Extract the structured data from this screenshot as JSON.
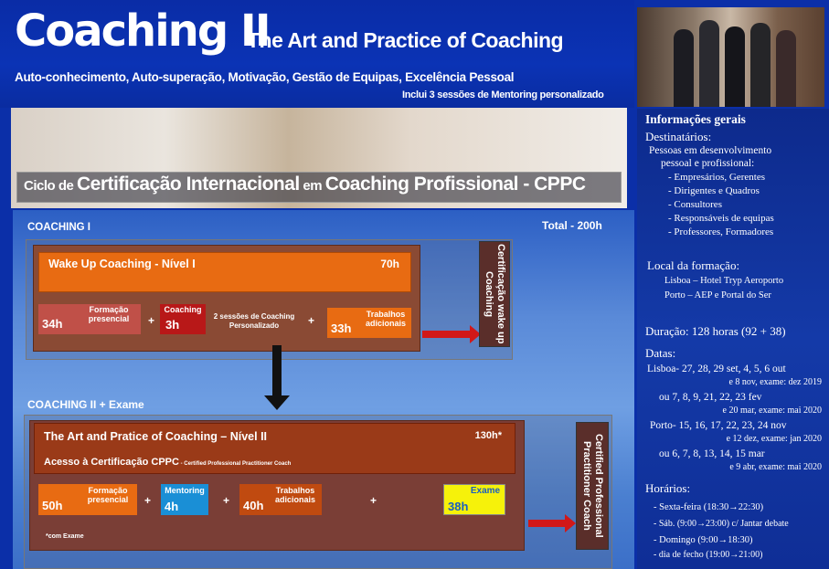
{
  "header": {
    "title_main": "Coaching II",
    "title_sub": "The  Art and Practice  of Coaching",
    "tagline": "Auto-conhecimento, Auto-superação, Motivação, Gestão de Equipas, Excelência Pessoal",
    "mentoring_note": "Inclui 3 sessões de Mentoring personalizado"
  },
  "banner": {
    "cppc_small1": "Ciclo de ",
    "cppc_big1": "Certificação Internacional",
    "cppc_small2": " em ",
    "cppc_big2": "Coaching Profissional  -  CPPC"
  },
  "coaching1": {
    "label": "COACHING I",
    "total": "Total - 200h",
    "module_title": "Wake Up Coaching - Nível I",
    "module_hours": "70h",
    "formacao_hours": "34h",
    "formacao_label": "Formação presencial",
    "coaching_label": "Coaching",
    "coaching_hours": "3h",
    "sessoes_label": "2 sessões de Coaching  Personalizado",
    "trabalhos_hours": "33h",
    "trabalhos_label": "Trabalhos adicionais",
    "certification": "Certificação wake up Coaching",
    "plus": "+"
  },
  "coaching2": {
    "label": "COACHING II + Exame",
    "module_title": "The Art and Pratice of Coaching – Nível II",
    "module_hours": "130h*",
    "access": "Acesso à Certificação CPPC",
    "access_small": " - Certified Professional Practitioner Coach",
    "formacao_hours": "50h",
    "formacao_label": "Formação presencial",
    "mentoring_label": "Mentoring",
    "mentoring_hours": "4h",
    "trabalhos_hours": "40h",
    "trabalhos_label": "Trabalhos adicionais",
    "exame_label": "Exame",
    "exame_hours": "38h",
    "com_exame": "*com Exame",
    "certification": "Certified Professional Practitioner Coach",
    "plus": "+"
  },
  "sidebar": {
    "info_title": "Informações gerais",
    "destinatarios_title": "Destinatários:",
    "dest_line1": "Pessoas em desenvolvimento",
    "dest_line2": "pessoal e profissional:",
    "dest_items": [
      "- Empresários, Gerentes",
      "- Dirigentes e Quadros",
      "- Consultores",
      "- Responsáveis de equipas",
      "- Professores, Formadores"
    ],
    "local_title": "Local da formação:",
    "local_lisboa": "Lisboa – Hotel Tryp Aeroporto",
    "local_porto": "Porto –   AEP e Portal do Ser",
    "duracao": "Duração:  128 horas (92 + 38)",
    "datas_title": "Datas:",
    "datas_lisboa_1": "Lisboa-  27, 28, 29 set, 4, 5, 6 out",
    "datas_lisboa_2": "e 8 nov, exame: dez 2019",
    "datas_lisboa_ou_1": "ou     7, 8, 9, 21, 22, 23 fev",
    "datas_lisboa_ou_2": "e 20 mar, exame: mai  2020",
    "datas_porto_1": "Porto-  15, 16, 17, 22, 23, 24 nov",
    "datas_porto_2": "e 12 dez,   exame:  jan 2020",
    "datas_porto_ou_1": "ou      6, 7, 8, 13, 14, 15 mar",
    "datas_porto_ou_2": "e 9 abr,      exame:  mai  2020",
    "horarios_title": "Horários:",
    "horarios": [
      "- Sexta-feira (18:30→22:30)",
      "- Sáb. (9:00→23:00) c/ Jantar debate",
      "- Domingo (9:00→18:30)",
      "- dia de fecho (19:00→21:00)"
    ]
  }
}
